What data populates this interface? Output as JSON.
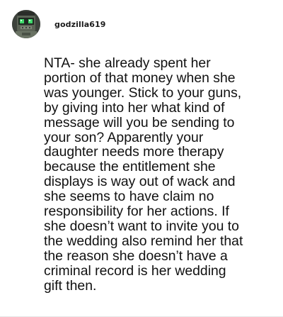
{
  "comment": {
    "username": "godzilla619",
    "avatar_icon": "robot-avatar-icon",
    "lines": [
      "NTA- she already spent her",
      "portion of that money when she",
      "was younger. Stick to your guns,",
      "by giving into her what kind of",
      "message will you be sending to",
      "your son? Apparently your",
      "daughter needs more therapy",
      "because the entitlement she",
      "displays is way out of wack and",
      "she seems to have claim no",
      "responsibility for her actions. If",
      "she doesn’t want to invite you to",
      "the wedding also remind her that",
      "the reason she doesn’t have a",
      "criminal record is her wedding",
      "gift then."
    ]
  }
}
